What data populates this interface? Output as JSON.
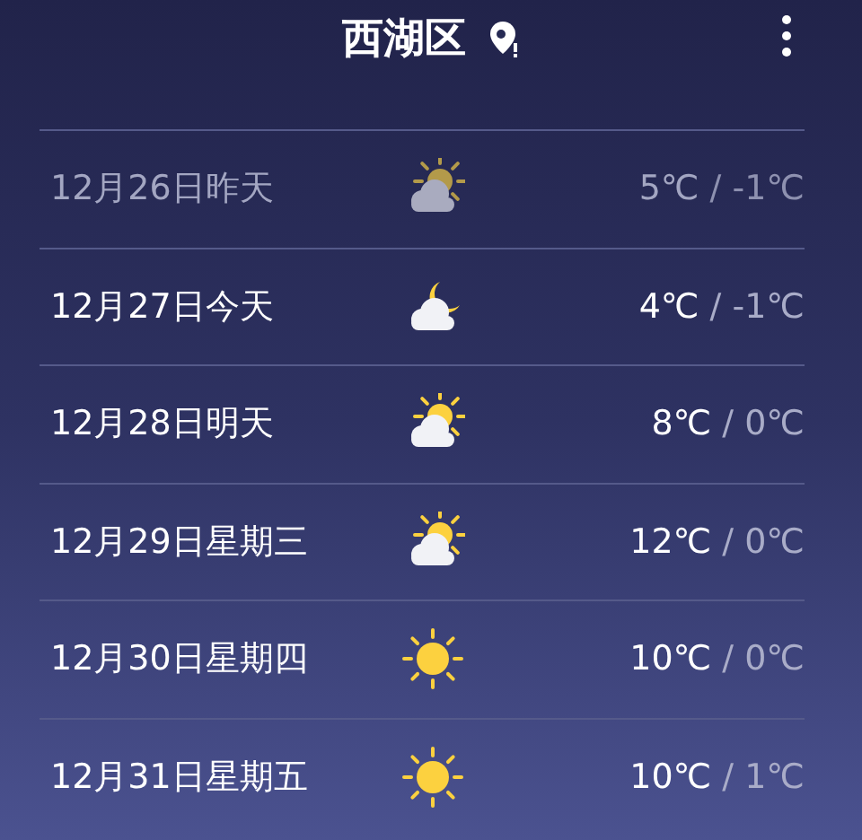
{
  "header": {
    "title": "西湖区"
  },
  "days": [
    {
      "date": "12月26日昨天",
      "kind": "cloud-sun",
      "high": "5℃",
      "low": "/ -1℃",
      "past": true
    },
    {
      "date": "12月27日今天",
      "kind": "cloud-moon",
      "high": "4℃",
      "low": "/ -1℃",
      "past": false
    },
    {
      "date": "12月28日明天",
      "kind": "cloud-sun",
      "high": "8℃",
      "low": "/ 0℃",
      "past": false
    },
    {
      "date": "12月29日星期三",
      "kind": "cloud-sun",
      "high": "12℃",
      "low": "/ 0℃",
      "past": false
    },
    {
      "date": "12月30日星期四",
      "kind": "sun",
      "high": "10℃",
      "low": "/ 0℃",
      "past": false
    },
    {
      "date": "12月31日星期五",
      "kind": "sun",
      "high": "10℃",
      "low": "/ 1℃",
      "past": false
    }
  ]
}
